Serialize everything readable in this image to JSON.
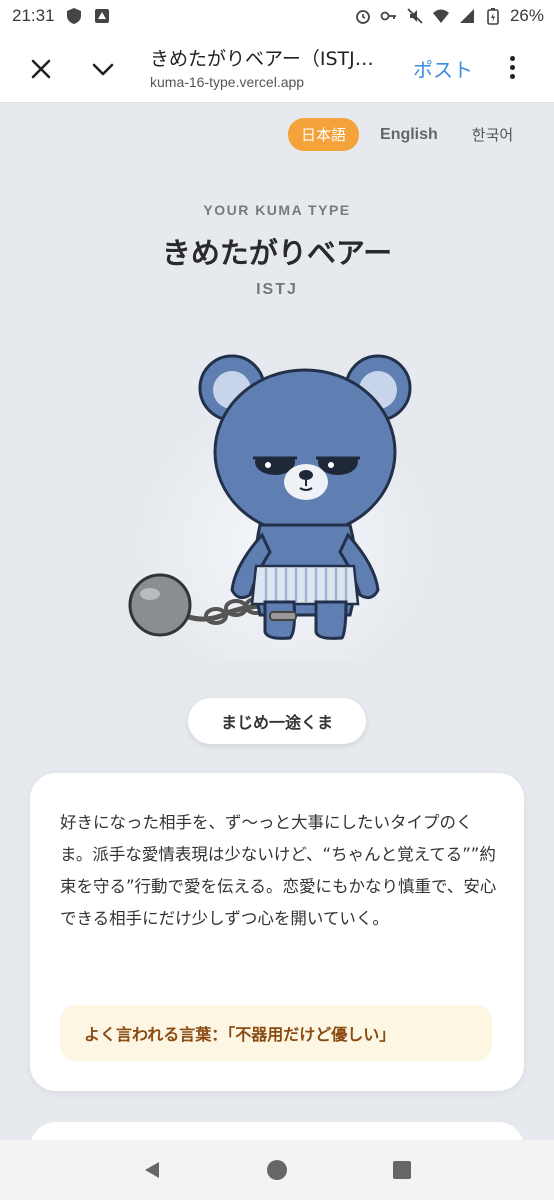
{
  "status": {
    "time": "21:31",
    "battery": "26%"
  },
  "browser": {
    "title": "きめたがりベアー（ISTJ…",
    "url": "kuma-16-type.vercel.app",
    "post_label": "ポスト"
  },
  "languages": [
    {
      "label": "日本語",
      "active": true
    },
    {
      "label": "English",
      "active": false
    },
    {
      "label": "한국어",
      "active": false
    }
  ],
  "result": {
    "eyebrow": "YOUR KUMA TYPE",
    "title": "きめたがりベアー",
    "code": "ISTJ",
    "nickname": "まじめ一途くま",
    "description": "好きになった相手を、ず〜っと大事にしたいタイプのくま。派手な愛情表現は少ないけど、“ちゃんと覚えてる””約束を守る”行動で愛を伝える。恋愛にもかなり慎重で、安心できる相手にだけ少しずつ心を開いていく。",
    "quote": "よく言われる言葉：「不器用だけど優しい」"
  },
  "colors": {
    "accent": "#f4a23a",
    "link": "#3b8de0",
    "bear": "#5f7fb3",
    "background": "#e6e9ee"
  },
  "icons": {
    "close": "close-icon",
    "chevron": "chevron-down-icon",
    "menu": "more-vert-icon",
    "back": "back-icon",
    "home": "home-icon",
    "recents": "recents-icon"
  }
}
